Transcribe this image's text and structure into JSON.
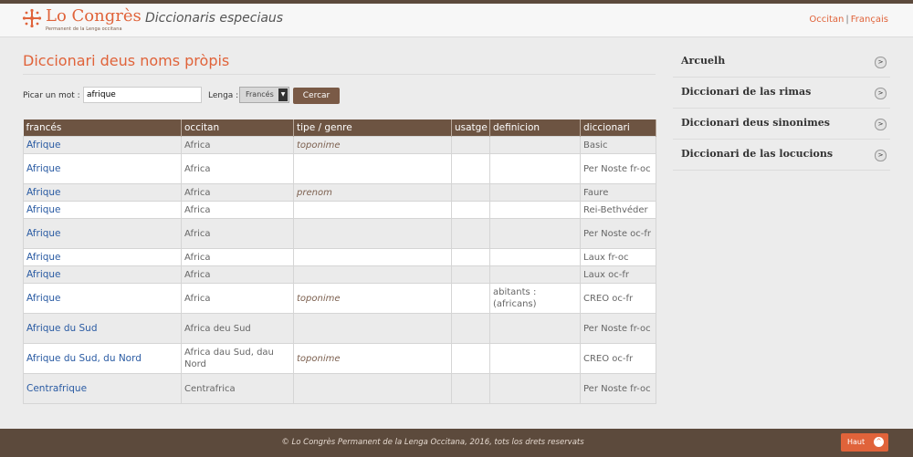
{
  "header": {
    "logo_text": "Lo Congrès",
    "logo_subtitle": "Permanent de la Lenga occitana",
    "site_subtitle": "Diccionaris especiaus",
    "lang_occitan": "Occitan",
    "lang_sep": "|",
    "lang_frances": "Français"
  },
  "main": {
    "title": "Diccionari deus noms pròpis",
    "search": {
      "label": "Picar un mot :",
      "value": "afrique",
      "lang_label": "Lenga :",
      "lang_value": "Francés",
      "button": "Cercar"
    },
    "table": {
      "headers": [
        "francés",
        "occitan",
        "tipe / genre",
        "usatge",
        "definicion",
        "diccionari"
      ],
      "rows": [
        [
          "Afrique",
          "Africa",
          "toponime",
          "",
          "",
          "Basic"
        ],
        [
          "Afrique",
          "Africa",
          "",
          "",
          "",
          "Per Noste fr-oc"
        ],
        [
          "Afrique",
          "Africa",
          "prenom",
          "",
          "",
          "Faure"
        ],
        [
          "Afrique",
          "Africa",
          "",
          "",
          "",
          "Rei-Bethvéder"
        ],
        [
          "Afrique",
          "Africa",
          "",
          "",
          "",
          "Per Noste oc-fr"
        ],
        [
          "Afrique",
          "Africa",
          "",
          "",
          "",
          "Laux fr-oc"
        ],
        [
          "Afrique",
          "Africa",
          "",
          "",
          "",
          "Laux oc-fr"
        ],
        [
          "Afrique",
          "Africa",
          "toponime",
          "",
          "abitants : (africans)",
          "CREO oc-fr"
        ],
        [
          "Afrique du Sud",
          "Africa deu Sud",
          "",
          "",
          "",
          "Per Noste fr-oc"
        ],
        [
          "Afrique du Sud, du Nord",
          "Africa dau Sud, dau Nord",
          "toponime",
          "",
          "",
          "CREO oc-fr"
        ],
        [
          "Centrafrique",
          "Centrafrica",
          "",
          "",
          "",
          "Per Noste fr-oc"
        ]
      ]
    }
  },
  "sidebar": {
    "items": [
      {
        "label": "Arcuelh",
        "icon": "chevron-right-icon"
      },
      {
        "label": "Diccionari de las rimas",
        "icon": "chevron-right-icon"
      },
      {
        "label": "Diccionari deus sinonimes",
        "icon": "chevron-right-icon"
      },
      {
        "label": "Diccionari de las locucions",
        "icon": "chevron-right-icon"
      }
    ]
  },
  "footer": {
    "text": "© Lo Congrès Permanent de la Lenga Occitana, 2016, tots los drets reservats",
    "haut_label": "Haut"
  },
  "colors": {
    "accent": "#e0633a",
    "brown": "#6d5442",
    "dark_brown": "#5c4a3c",
    "link_blue": "#2a5ba3"
  }
}
